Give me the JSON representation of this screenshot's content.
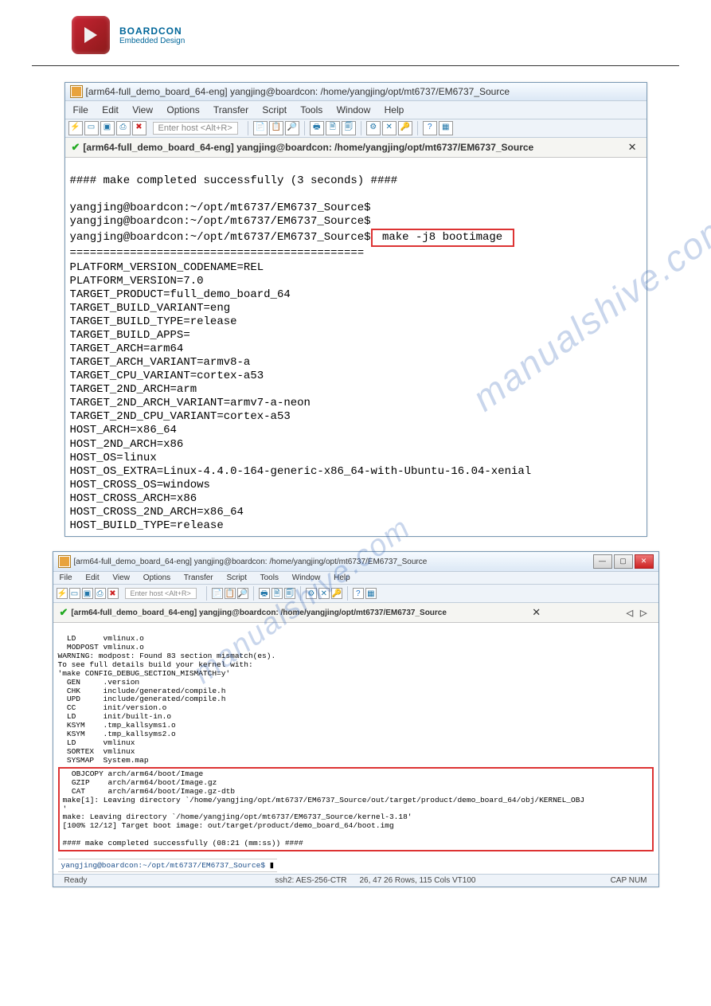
{
  "brand": {
    "title": "BOARDCON",
    "subtitle": "Embedded Design"
  },
  "watermark": "manualshive.com",
  "menu": {
    "file": "File",
    "edit": "Edit",
    "view": "View",
    "options": "Options",
    "transfer": "Transfer",
    "script": "Script",
    "tools": "Tools",
    "window": "Window",
    "help": "Help"
  },
  "host_placeholder": "Enter host <Alt+R>",
  "win1": {
    "title": "[arm64-full_demo_board_64-eng] yangjing@boardcon: /home/yangjing/opt/mt6737/EM6737_Source",
    "tab": "[arm64-full_demo_board_64-eng] yangjing@boardcon: /home/yangjing/opt/mt6737/EM6737_Source",
    "line_complete": "#### make completed successfully (3 seconds) ####",
    "prompt1": "yangjing@boardcon:~/opt/mt6737/EM6737_Source$",
    "prompt2": "yangjing@boardcon:~/opt/mt6737/EM6737_Source$",
    "prompt3": "yangjing@boardcon:~/opt/mt6737/EM6737_Source$",
    "cmd": " make -j8 bootimage ",
    "divider": "============================================",
    "vars": [
      "PLATFORM_VERSION_CODENAME=REL",
      "PLATFORM_VERSION=7.0",
      "TARGET_PRODUCT=full_demo_board_64",
      "TARGET_BUILD_VARIANT=eng",
      "TARGET_BUILD_TYPE=release",
      "TARGET_BUILD_APPS=",
      "TARGET_ARCH=arm64",
      "TARGET_ARCH_VARIANT=armv8-a",
      "TARGET_CPU_VARIANT=cortex-a53",
      "TARGET_2ND_ARCH=arm",
      "TARGET_2ND_ARCH_VARIANT=armv7-a-neon",
      "TARGET_2ND_CPU_VARIANT=cortex-a53",
      "HOST_ARCH=x86_64",
      "HOST_2ND_ARCH=x86",
      "HOST_OS=linux",
      "HOST_OS_EXTRA=Linux-4.4.0-164-generic-x86_64-with-Ubuntu-16.04-xenial",
      "HOST_CROSS_OS=windows",
      "HOST_CROSS_ARCH=x86",
      "HOST_CROSS_2ND_ARCH=x86_64",
      "HOST_BUILD_TYPE=release"
    ]
  },
  "win2": {
    "title": "[arm64-full_demo_board_64-eng] yangjing@boardcon: /home/yangjing/opt/mt6737/EM6737_Source",
    "tab": "[arm64-full_demo_board_64-eng] yangjing@boardcon: /home/yangjing/opt/mt6737/EM6737_Source",
    "upper": [
      "  LD      vmlinux.o",
      "  MODPOST vmlinux.o",
      "WARNING: modpost: Found 83 section mismatch(es).",
      "To see full details build your kernel with:",
      "'make CONFIG_DEBUG_SECTION_MISMATCH=y'",
      "  GEN     .version",
      "  CHK     include/generated/compile.h",
      "  UPD     include/generated/compile.h",
      "  CC      init/version.o",
      "  LD      init/built-in.o",
      "  KSYM    .tmp_kallsyms1.o",
      "  KSYM    .tmp_kallsyms2.o",
      "  LD      vmlinux",
      "  SORTEX  vmlinux",
      "  SYSMAP  System.map"
    ],
    "boxed": [
      "  OBJCOPY arch/arm64/boot/Image",
      "  GZIP    arch/arm64/boot/Image.gz",
      "  CAT     arch/arm64/boot/Image.gz-dtb",
      "make[1]: Leaving directory `/home/yangjing/opt/mt6737/EM6737_Source/out/target/product/demo_board_64/obj/KERNEL_OBJ",
      "'",
      "make: Leaving directory `/home/yangjing/opt/mt6737/EM6737_Source/kernel-3.18'",
      "[100% 12/12] Target boot image: out/target/product/demo_board_64/boot.img",
      "",
      "#### make completed successfully (08:21 (mm:ss)) ####"
    ],
    "final_prompt": "yangjing@boardcon:~/opt/mt6737/EM6737_Source$ ",
    "cursor": "▮",
    "status": {
      "ready": "Ready",
      "ssh": "ssh2: AES-256-CTR",
      "pos": "26, 47   26 Rows, 115 Cols   VT100",
      "cap": "CAP  NUM"
    }
  }
}
